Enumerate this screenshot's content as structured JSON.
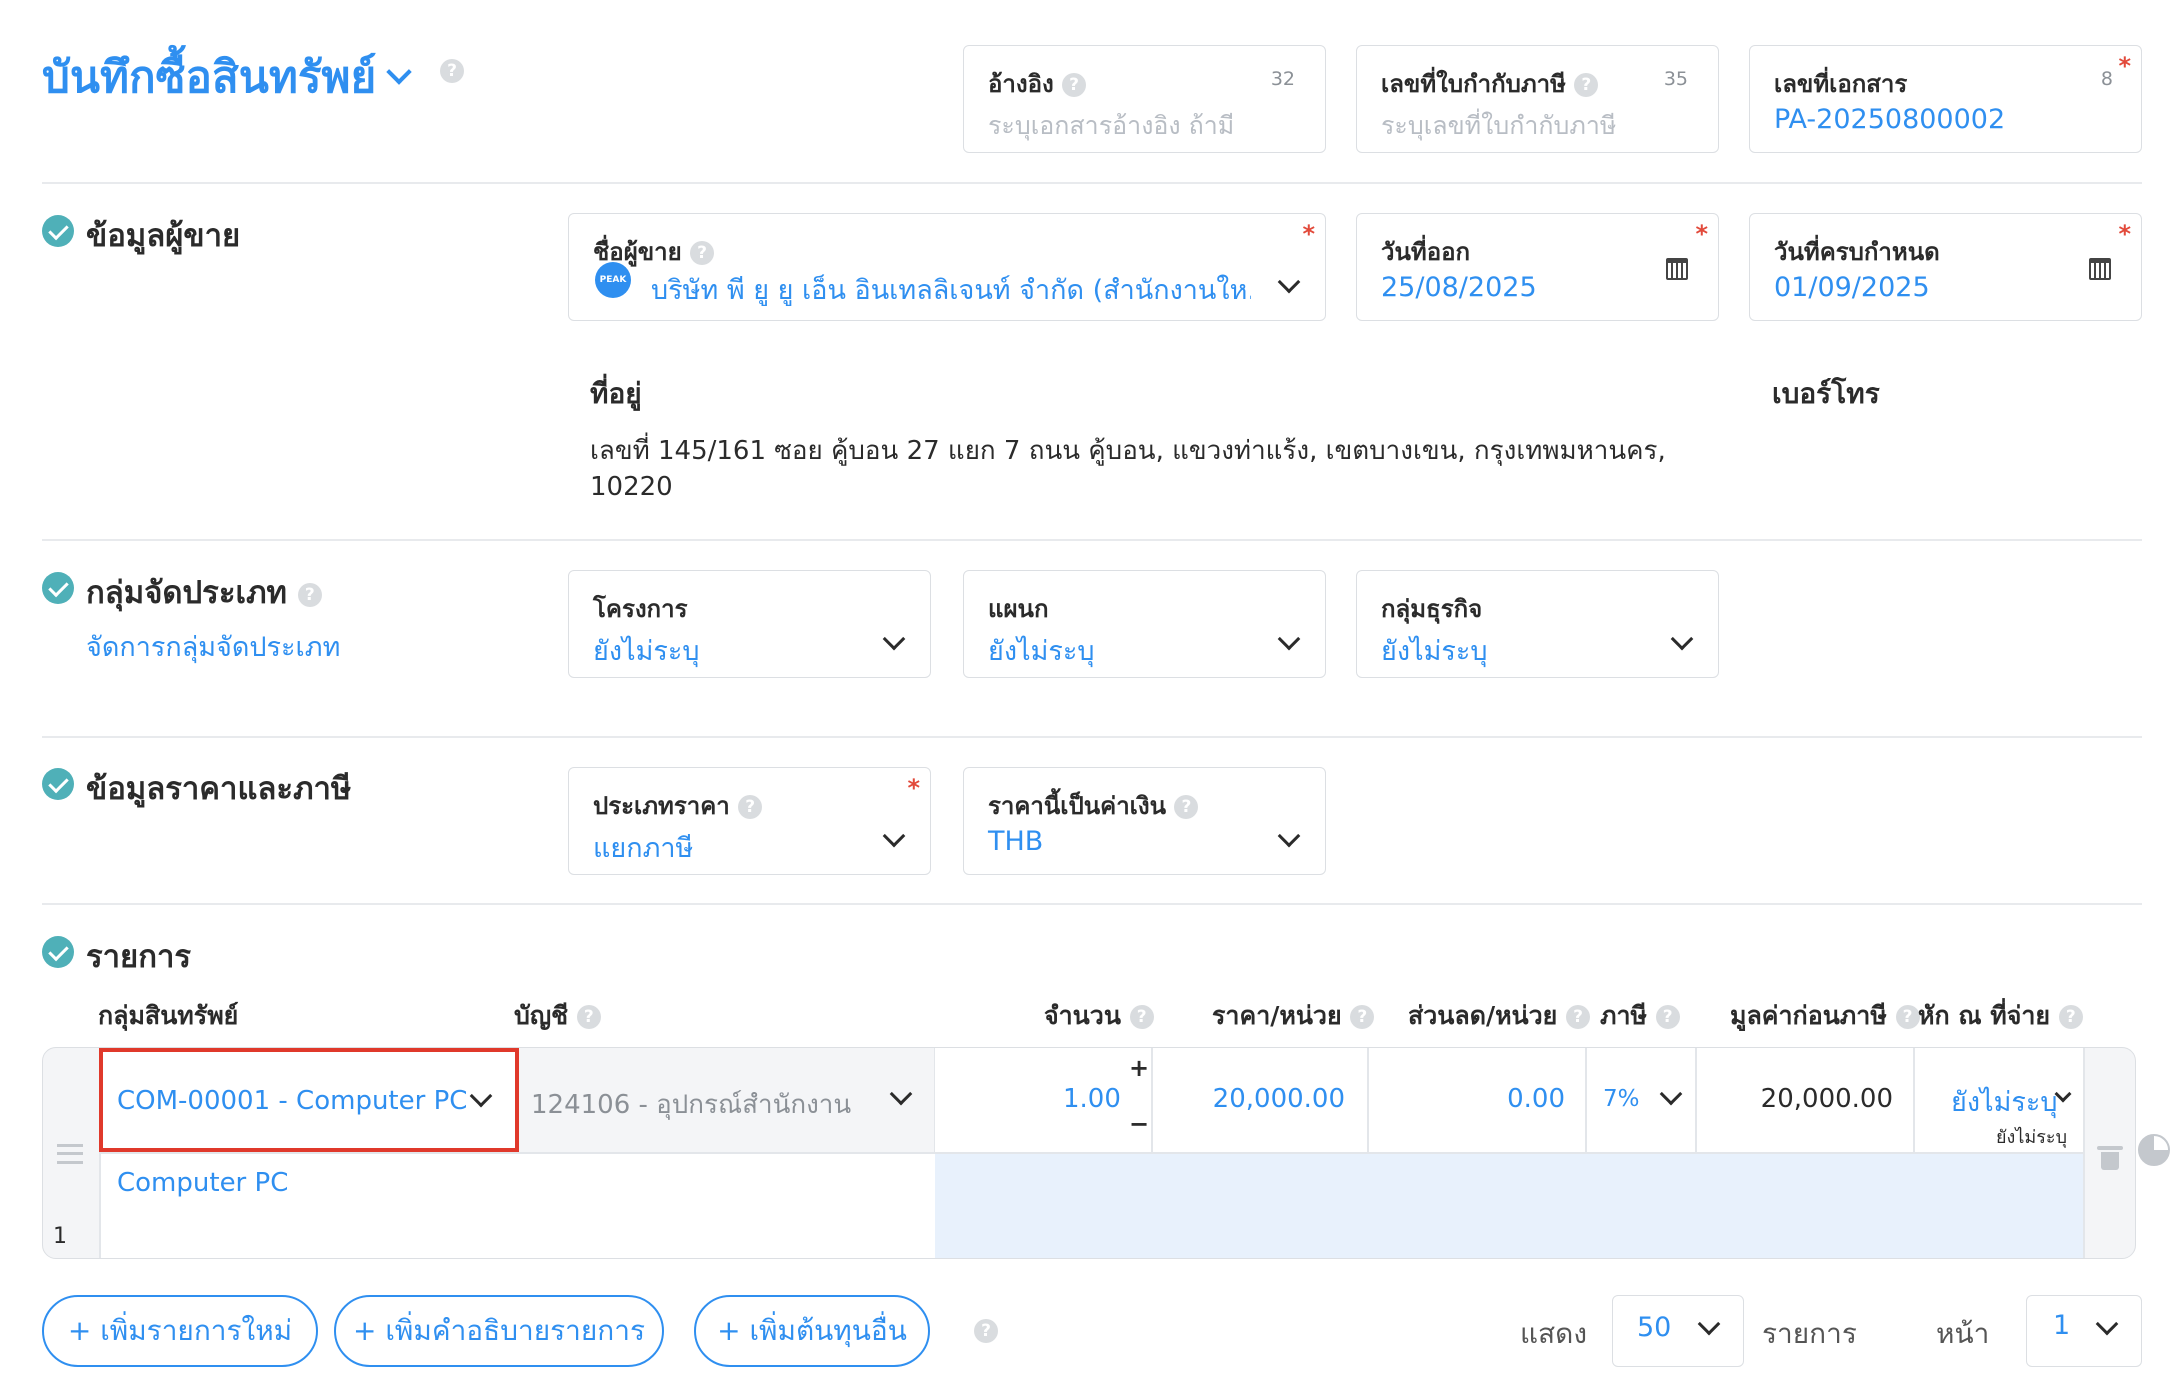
{
  "header": {
    "title": "บันทึกซื้อสินทรัพย์",
    "reference": {
      "label": "อ้างอิง",
      "count": "32",
      "placeholder": "ระบุเอกสารอ้างอิง ถ้ามี"
    },
    "tax_invoice": {
      "label": "เลขที่ใบกำกับภาษี",
      "count": "35",
      "placeholder": "ระบุเลขที่ใบกำกับภาษี"
    },
    "document_no": {
      "label": "เลขที่เอกสาร",
      "count": "8",
      "value": "PA-20250800002"
    }
  },
  "vendor_section": {
    "title": "ข้อมูลผู้ขาย",
    "vendor_label": "ชื่อผู้ขาย",
    "vendor_logo": "PEAK",
    "vendor_value": "บริษัท พี ยู ยู เอ็น อินเทลลิเจนท์ จำกัด (สำนักงานให...",
    "issue_date_label": "วันที่ออก",
    "issue_date": "25/08/2025",
    "due_date_label": "วันที่ครบกำหนด",
    "due_date": "01/09/2025",
    "address_label": "ที่อยู่",
    "address_line1": "เลขที่ 145/161 ซอย คู้บอน 27 แยก 7 ถนน คู้บอน, แขวงท่าแร้ง, เขตบางเขน, กรุงเทพมหานคร,",
    "address_line2": "10220",
    "phone_label": "เบอร์โทร"
  },
  "category_section": {
    "title": "กลุ่มจัดประเภท",
    "manage_link": "จัดการกลุ่มจัดประเภท",
    "project_label": "โครงการ",
    "project_value": "ยังไม่ระบุ",
    "department_label": "แผนก",
    "department_value": "ยังไม่ระบุ",
    "business_label": "กลุ่มธุรกิจ",
    "business_value": "ยังไม่ระบุ"
  },
  "price_section": {
    "title": "ข้อมูลราคาและภาษี",
    "price_type_label": "ประเภทราคา",
    "price_type_value": "แยกภาษี",
    "currency_label": "ราคานี้เป็นค่าเงิน",
    "currency_value": "THB"
  },
  "items_section": {
    "title": "รายการ",
    "columns": {
      "asset_group": "กลุ่มสินทรัพย์",
      "account": "บัญชี",
      "quantity": "จำนวน",
      "unit_price": "ราคา/หน่วย",
      "discount": "ส่วนลด/หน่วย",
      "tax": "ภาษี",
      "pre_tax": "มูลค่าก่อนภาษี",
      "withholding": "หัก ณ ที่จ่าย"
    },
    "row": {
      "number": "1",
      "asset_group": "COM-00001 - Computer PC",
      "account": "124106 - อุปกรณ์สำนักงาน",
      "quantity": "1.00",
      "plus": "+",
      "minus": "−",
      "unit_price": "20,000.00",
      "discount": "0.00",
      "tax": "7%",
      "pre_tax": "20,000.00",
      "withholding": "ยังไม่ระบุ",
      "withholding_sub": "ยังไม่ระบุ",
      "description": "Computer PC"
    }
  },
  "footer": {
    "add_item": "+ เพิ่มรายการใหม่",
    "add_description": "+ เพิ่มคำอธิบายรายการ",
    "add_cost": "+ เพิ่มต้นทุนอื่น",
    "show_label": "แสดง",
    "per_page": "50",
    "items_label": "รายการ",
    "page_label": "หน้า",
    "page": "1"
  },
  "colors": {
    "accent": "#2f8ff0",
    "check": "#4fb0b8",
    "required": "#e24a3b",
    "highlight": "#e0392b",
    "row_bg": "#e8f1fc"
  }
}
